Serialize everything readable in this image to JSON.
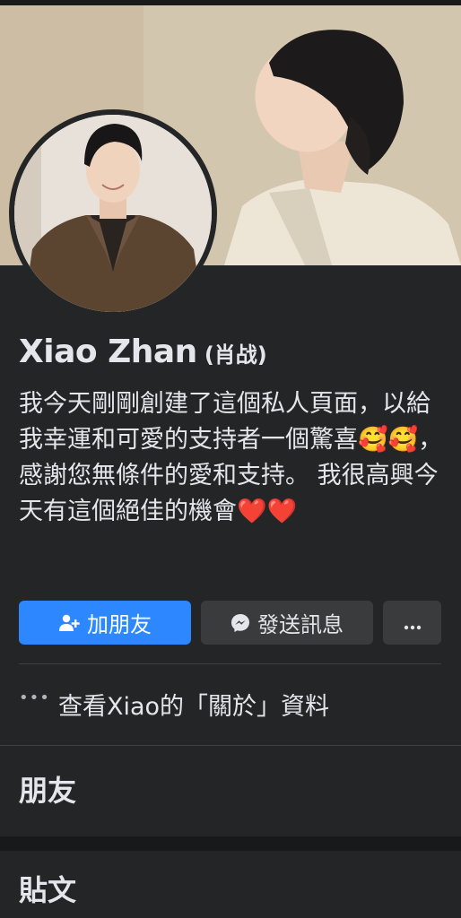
{
  "profile": {
    "name": "Xiao Zhan",
    "alternate_name": "(肖战)",
    "bio": "我今天剛剛創建了這個私人頁面，以給我幸運和可愛的支持者一個驚喜🥰🥰，感謝您無條件的愛和支持。 我很高興今天有這個絕佳的機會❤️❤️"
  },
  "actions": {
    "add_friend": "加朋友",
    "send_message": "發送訊息",
    "more_icon": "more-horizontal-icon"
  },
  "about": {
    "label": "查看Xiao的「關於」資料"
  },
  "sections": {
    "friends": "朋友",
    "posts": "貼文"
  },
  "colors": {
    "background": "#242526",
    "primary_button": "#2d88ff",
    "secondary_button": "#3a3b3c",
    "text": "#e4e6eb"
  }
}
